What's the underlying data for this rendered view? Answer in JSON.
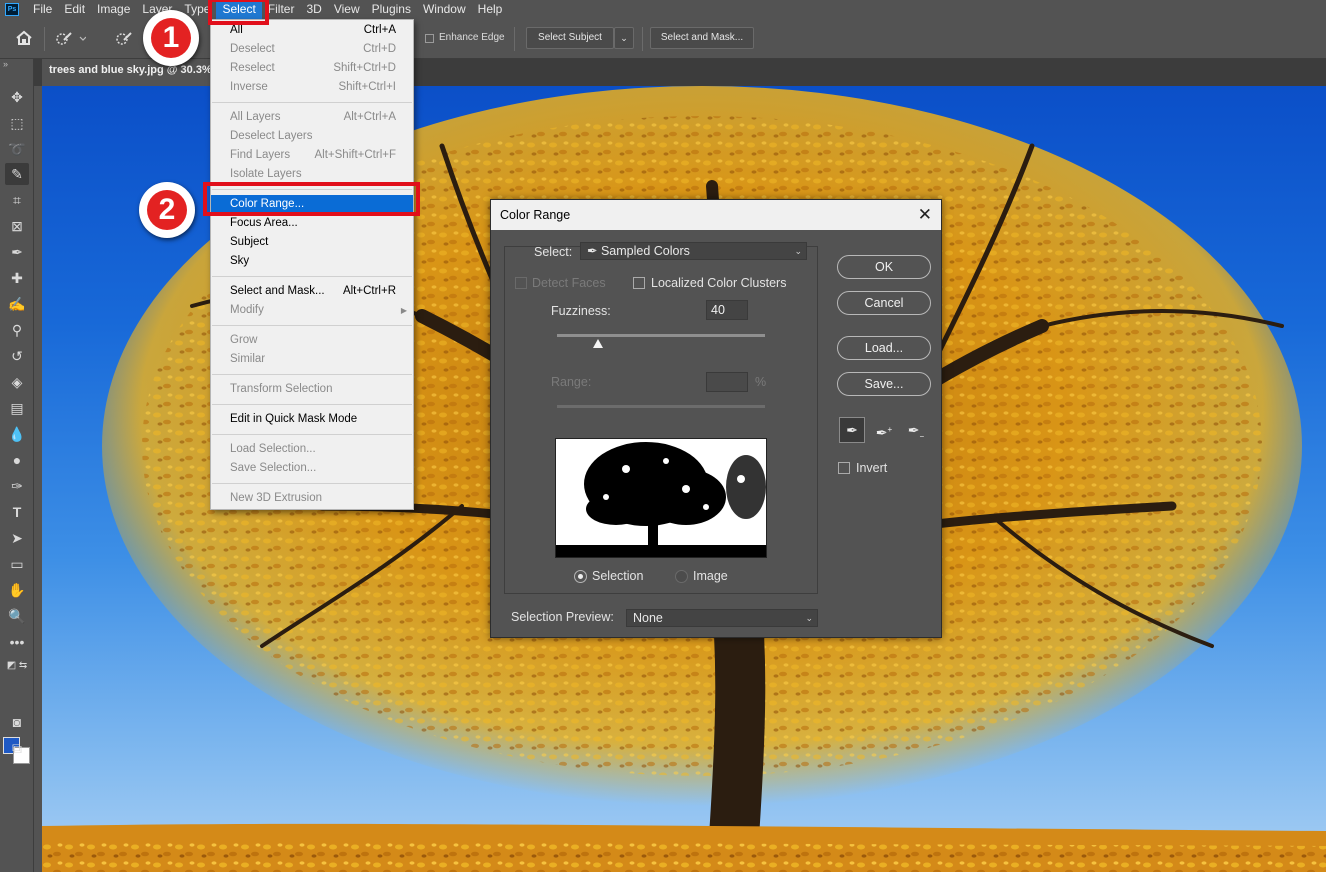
{
  "app": {
    "logo_text": "Ps"
  },
  "menubar": [
    "File",
    "Edit",
    "Image",
    "Layer",
    "Type",
    "Select",
    "Filter",
    "3D",
    "View",
    "Plugins",
    "Window",
    "Help"
  ],
  "options_bar": {
    "enhance_edge": "Enhance Edge",
    "select_subject": "Select Subject",
    "select_and_mask": "Select and Mask..."
  },
  "document_tab": "trees and blue sky.jpg @ 30.3%",
  "select_menu": {
    "items": [
      {
        "label": "All",
        "shortcut": "Ctrl+A",
        "enabled": true
      },
      {
        "label": "Deselect",
        "shortcut": "Ctrl+D",
        "enabled": false
      },
      {
        "label": "Reselect",
        "shortcut": "Shift+Ctrl+D",
        "enabled": false
      },
      {
        "label": "Inverse",
        "shortcut": "Shift+Ctrl+I",
        "enabled": false
      },
      {
        "label": "All Layers",
        "shortcut": "Alt+Ctrl+A",
        "enabled": false
      },
      {
        "label": "Deselect Layers",
        "shortcut": "",
        "enabled": false
      },
      {
        "label": "Find Layers",
        "shortcut": "Alt+Shift+Ctrl+F",
        "enabled": false
      },
      {
        "label": "Isolate Layers",
        "shortcut": "",
        "enabled": false
      },
      {
        "label": "Color Range...",
        "shortcut": "",
        "enabled": true,
        "highlighted": true
      },
      {
        "label": "Focus Area...",
        "shortcut": "",
        "enabled": true
      },
      {
        "label": "Subject",
        "shortcut": "",
        "enabled": true
      },
      {
        "label": "Sky",
        "shortcut": "",
        "enabled": true
      },
      {
        "label": "Select and Mask...",
        "shortcut": "Alt+Ctrl+R",
        "enabled": true
      },
      {
        "label": "Modify",
        "shortcut": "",
        "enabled": false,
        "submenu": true
      },
      {
        "label": "Grow",
        "shortcut": "",
        "enabled": false
      },
      {
        "label": "Similar",
        "shortcut": "",
        "enabled": false
      },
      {
        "label": "Transform Selection",
        "shortcut": "",
        "enabled": false
      },
      {
        "label": "Edit in Quick Mask Mode",
        "shortcut": "",
        "enabled": true
      },
      {
        "label": "Load Selection...",
        "shortcut": "",
        "enabled": false
      },
      {
        "label": "Save Selection...",
        "shortcut": "",
        "enabled": false
      },
      {
        "label": "New 3D Extrusion",
        "shortcut": "",
        "enabled": false
      }
    ]
  },
  "callouts": [
    "1",
    "2"
  ],
  "color_range_dialog": {
    "title": "Color Range",
    "select_label": "Select:",
    "select_value": "Sampled Colors",
    "detect_faces": "Detect Faces",
    "localized_clusters": "Localized Color Clusters",
    "fuzziness_label": "Fuzziness:",
    "fuzziness_value": "40",
    "range_label": "Range:",
    "range_unit": "%",
    "radio_selection": "Selection",
    "radio_image": "Image",
    "preview_label": "Selection Preview:",
    "preview_value": "None",
    "buttons": {
      "ok": "OK",
      "cancel": "Cancel",
      "load": "Load...",
      "save": "Save..."
    },
    "invert": "Invert"
  }
}
